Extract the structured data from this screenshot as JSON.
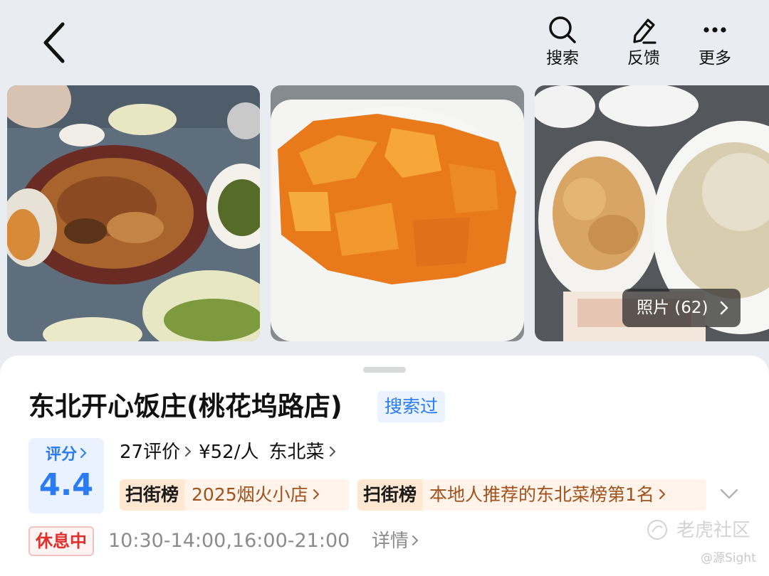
{
  "nav": {
    "search_label": "搜索",
    "feedback_label": "反馈",
    "more_label": "更多"
  },
  "gallery": {
    "photo_count_label": "照片 (62)",
    "photos": [
      "stewed-dish-photo",
      "fried-pumpkin-photo",
      "fried-dishes-photo"
    ]
  },
  "shop": {
    "name": "东北开心饭庄(桃花坞路店)",
    "searched_badge": "搜索过",
    "score_label": "评分",
    "score_value": "4.4",
    "reviews": "27评价",
    "price": "¥52/人",
    "cuisine": "东北菜",
    "ranks": [
      {
        "brand": "扫街榜",
        "text": "2025烟火小店"
      },
      {
        "brand": "扫街榜",
        "text": "本地人推荐的东北菜榜第1名"
      }
    ],
    "status": "休息中",
    "hours": "10:30-14:00,16:00-21:00",
    "detail_label": "详情"
  },
  "watermark": {
    "main": "老虎社区",
    "sub": "@源Sight"
  },
  "colors": {
    "accent": "#2a7cf6",
    "status_red": "#e0302b",
    "rank_text": "#a0521d"
  }
}
